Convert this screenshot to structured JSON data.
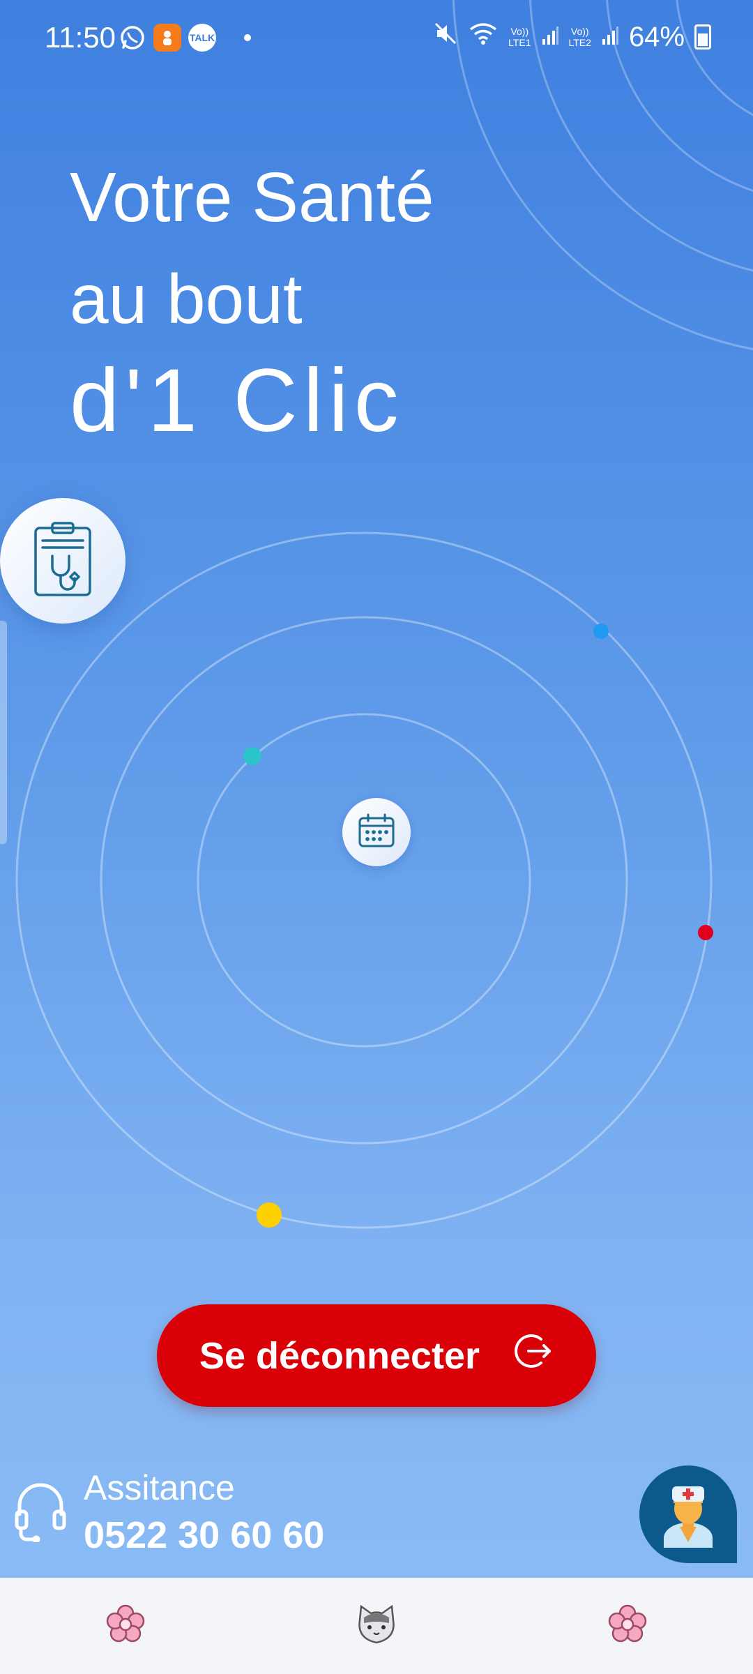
{
  "status_bar": {
    "time": "11:50",
    "battery": "64%",
    "net1_top": "Vo))",
    "net1_bottom": "LTE1",
    "net2_top": "Vo))",
    "net2_bottom": "LTE2",
    "notification_icons": [
      "whatsapp-icon",
      "messenger-app-icon",
      "talk-chat-icon"
    ],
    "talk_label": "TALK"
  },
  "hero": {
    "line1": "Votre Santé",
    "line2": "au bout",
    "line3": "d'1 Clic"
  },
  "orbit": {
    "dot_colors": [
      "#1e9bf0",
      "#2bc4c8",
      "#e0001b",
      "#ffd000"
    ],
    "center_icon": "calendar-icon",
    "side_icon": "clipboard-stethoscope-icon"
  },
  "logout": {
    "label": "Se déconnecter",
    "icon": "logout-icon",
    "color": "#d90008"
  },
  "assistance": {
    "label": "Assitance",
    "phone": "0522 30 60 60",
    "icon": "headset-icon"
  },
  "fab": {
    "icon": "doctor-avatar-icon",
    "color": "#0c5a8c"
  },
  "nav": {
    "items": [
      "flower-icon",
      "cat-icon",
      "flower-icon"
    ]
  }
}
